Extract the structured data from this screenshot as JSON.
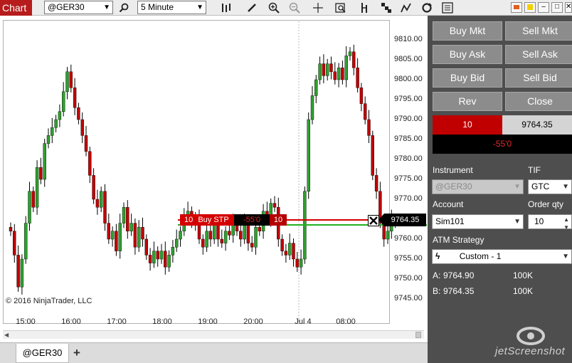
{
  "toolbar": {
    "title": "Chart",
    "instrument": "@GER30",
    "interval": "5 Minute",
    "icons": [
      "search-icon",
      "bar-type-icon",
      "pencil-icon",
      "zoom-in-icon",
      "zoom-out-icon",
      "crosshair-icon",
      "data-box-icon",
      "indicators-icon",
      "strategies-icon",
      "drawing-tools-icon",
      "reload-icon",
      "properties-icon"
    ],
    "window_buttons": [
      "link-icon",
      "color-icon",
      "minimize-icon",
      "maximize-icon",
      "close-icon"
    ]
  },
  "chart": {
    "copyright": "© 2016 NinjaTrader, LLC",
    "y_ticks": [
      "9810.00",
      "9805.00",
      "9800.00",
      "9795.00",
      "9790.00",
      "9785.00",
      "9780.00",
      "9775.00",
      "9770.00",
      "9765.00",
      "9760.00",
      "9755.00",
      "9750.00",
      "9745.00"
    ],
    "x_ticks": [
      "15:00",
      "16:00",
      "17:00",
      "18:00",
      "19:00",
      "20:00",
      "Jul 4",
      "08:00"
    ],
    "current_price_label": "9764.35",
    "order": {
      "qty": "10",
      "type": "Buy STP",
      "pnl": "-55'0",
      "position_qty": "10"
    },
    "colors": {
      "up": "#2ea02e",
      "down": "#c00000",
      "wick": "#000000"
    }
  },
  "tabs": {
    "active": "@GER30",
    "add": "+"
  },
  "trader": {
    "buttons": {
      "buy_mkt": "Buy Mkt",
      "sell_mkt": "Sell Mkt",
      "buy_ask": "Buy Ask",
      "sell_ask": "Sell Ask",
      "buy_bid": "Buy Bid",
      "sell_bid": "Sell Bid",
      "rev": "Rev",
      "close": "Close"
    },
    "position": {
      "qty": "10",
      "avg_price": "9764.35",
      "pnl": "-55'0"
    },
    "instrument_label": "Instrument",
    "instrument_value": "@GER30",
    "tif_label": "TIF",
    "tif_value": "GTC",
    "account_label": "Account",
    "account_value": "Sim101",
    "order_qty_label": "Order qty",
    "order_qty_value": "10",
    "atm_label": "ATM Strategy",
    "atm_value": "Custom - 1",
    "ask_label": "A:",
    "ask_price": "9764.90",
    "ask_size": "100K",
    "bid_label": "B:",
    "bid_price": "9764.35",
    "bid_size": "100K"
  },
  "watermark": "jetScreenshot"
}
